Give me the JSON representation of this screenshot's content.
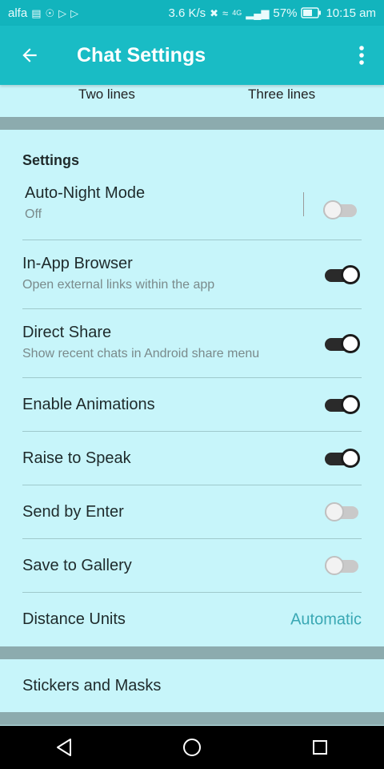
{
  "status_bar": {
    "carrier": "alfa",
    "network_speed": "3.6 K/s",
    "network_type": "4G",
    "battery": "57%",
    "time": "10:15 am"
  },
  "app_bar": {
    "title": "Chat Settings"
  },
  "message_lines": {
    "option_two": "Two lines",
    "option_three": "Three lines"
  },
  "settings": {
    "header": "Settings",
    "auto_night": {
      "label": "Auto-Night Mode",
      "value": "Off",
      "enabled": false
    },
    "in_app_browser": {
      "label": "In-App Browser",
      "sub": "Open external links within the app",
      "enabled": true
    },
    "direct_share": {
      "label": "Direct Share",
      "sub": "Show recent chats in Android share menu",
      "enabled": true
    },
    "animations": {
      "label": "Enable Animations",
      "enabled": true
    },
    "raise_to_speak": {
      "label": "Raise to Speak",
      "enabled": true
    },
    "send_by_enter": {
      "label": "Send by Enter",
      "enabled": false
    },
    "save_to_gallery": {
      "label": "Save to Gallery",
      "enabled": false
    },
    "distance_units": {
      "label": "Distance Units",
      "value": "Automatic"
    }
  },
  "stickers": {
    "label": "Stickers and Masks"
  },
  "colors": {
    "status_bar": "#12b4bd",
    "app_bar": "#19bcc5",
    "background": "#c7f5fa",
    "separator": "#8cabae",
    "accent_value": "#3aa8b4"
  }
}
